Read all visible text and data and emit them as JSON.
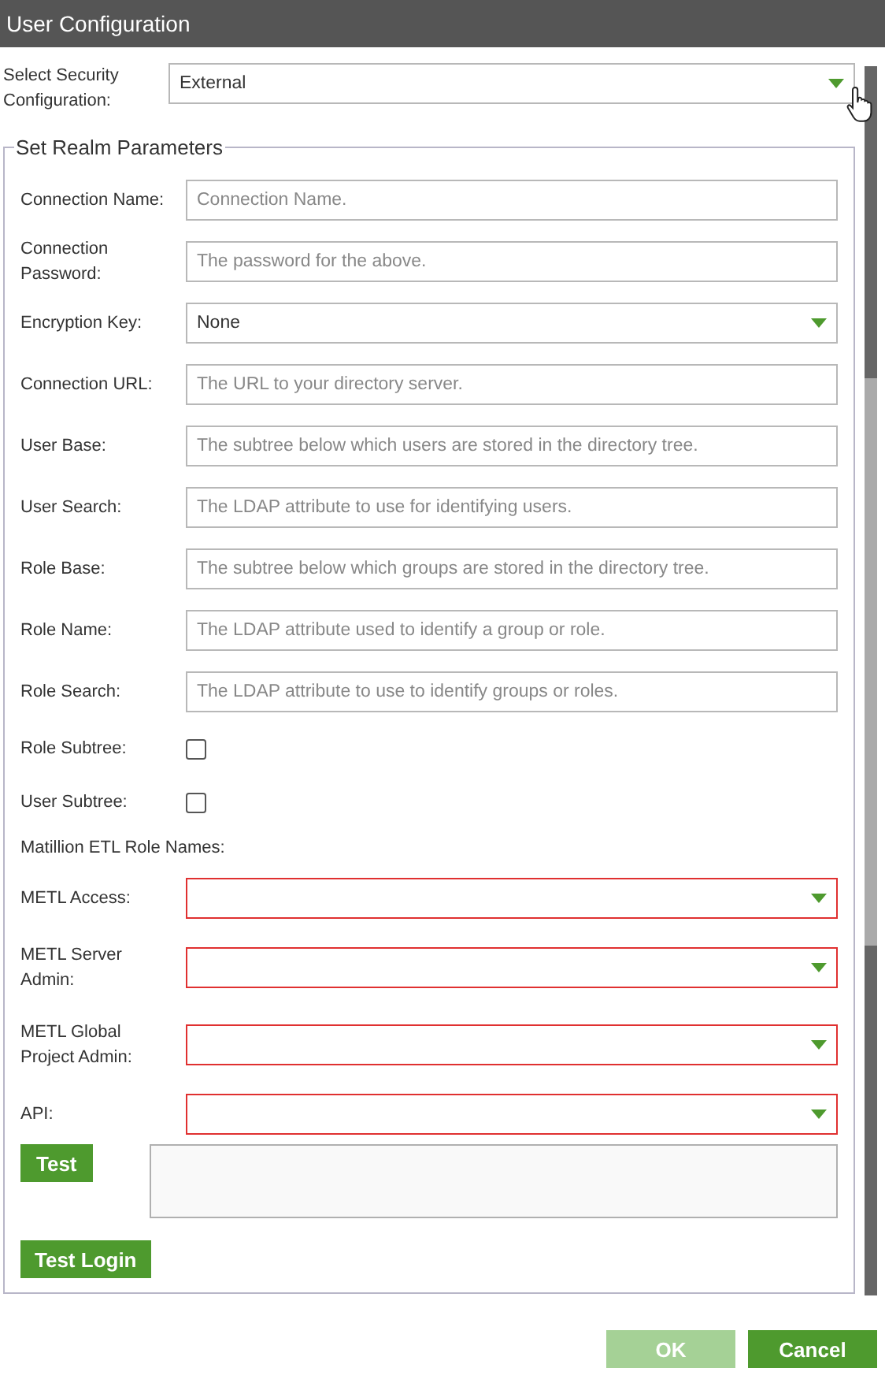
{
  "window": {
    "title": "User Configuration"
  },
  "security_configuration": {
    "label": "Select Security Configuration:",
    "value": "External"
  },
  "realm": {
    "legend": "Set Realm Parameters",
    "fields": [
      {
        "kind": "text",
        "label": "Connection Name:",
        "placeholder": "Connection Name."
      },
      {
        "kind": "text",
        "label": "Connection Password:",
        "placeholder": "The password for the above."
      },
      {
        "kind": "select",
        "label": "Encryption Key:",
        "value": "None",
        "invalid": false
      },
      {
        "kind": "text",
        "label": "Connection URL:",
        "placeholder": "The URL to your directory server."
      },
      {
        "kind": "text",
        "label": "User Base:",
        "placeholder": "The subtree below which users are stored in the directory tree."
      },
      {
        "kind": "text",
        "label": "User Search:",
        "placeholder": "The LDAP attribute to use for identifying users."
      },
      {
        "kind": "text",
        "label": "Role Base:",
        "placeholder": "The subtree below which groups are stored in the directory tree."
      },
      {
        "kind": "text",
        "label": "Role Name:",
        "placeholder": "The LDAP attribute used to identify a group or role."
      },
      {
        "kind": "text",
        "label": "Role Search:",
        "placeholder": "The LDAP attribute to use to identify groups or roles."
      },
      {
        "kind": "checkbox",
        "label": "Role Subtree:",
        "checked": false
      },
      {
        "kind": "checkbox",
        "label": "User Subtree:",
        "checked": false
      },
      {
        "kind": "heading",
        "label": "Matillion ETL Role Names:"
      },
      {
        "kind": "select",
        "label": "METL Access:",
        "invalid": true
      },
      {
        "kind": "select",
        "label": "METL Server Admin:",
        "invalid": true
      },
      {
        "kind": "select",
        "label": "METL Global Project Admin:",
        "invalid": true
      },
      {
        "kind": "select",
        "label": "API:",
        "invalid": true
      }
    ],
    "test_button": "Test",
    "test_login_button": "Test Login"
  },
  "footer_buttons": [
    {
      "label": "OK",
      "disabled": true
    },
    {
      "label": "Cancel",
      "disabled": false
    }
  ]
}
